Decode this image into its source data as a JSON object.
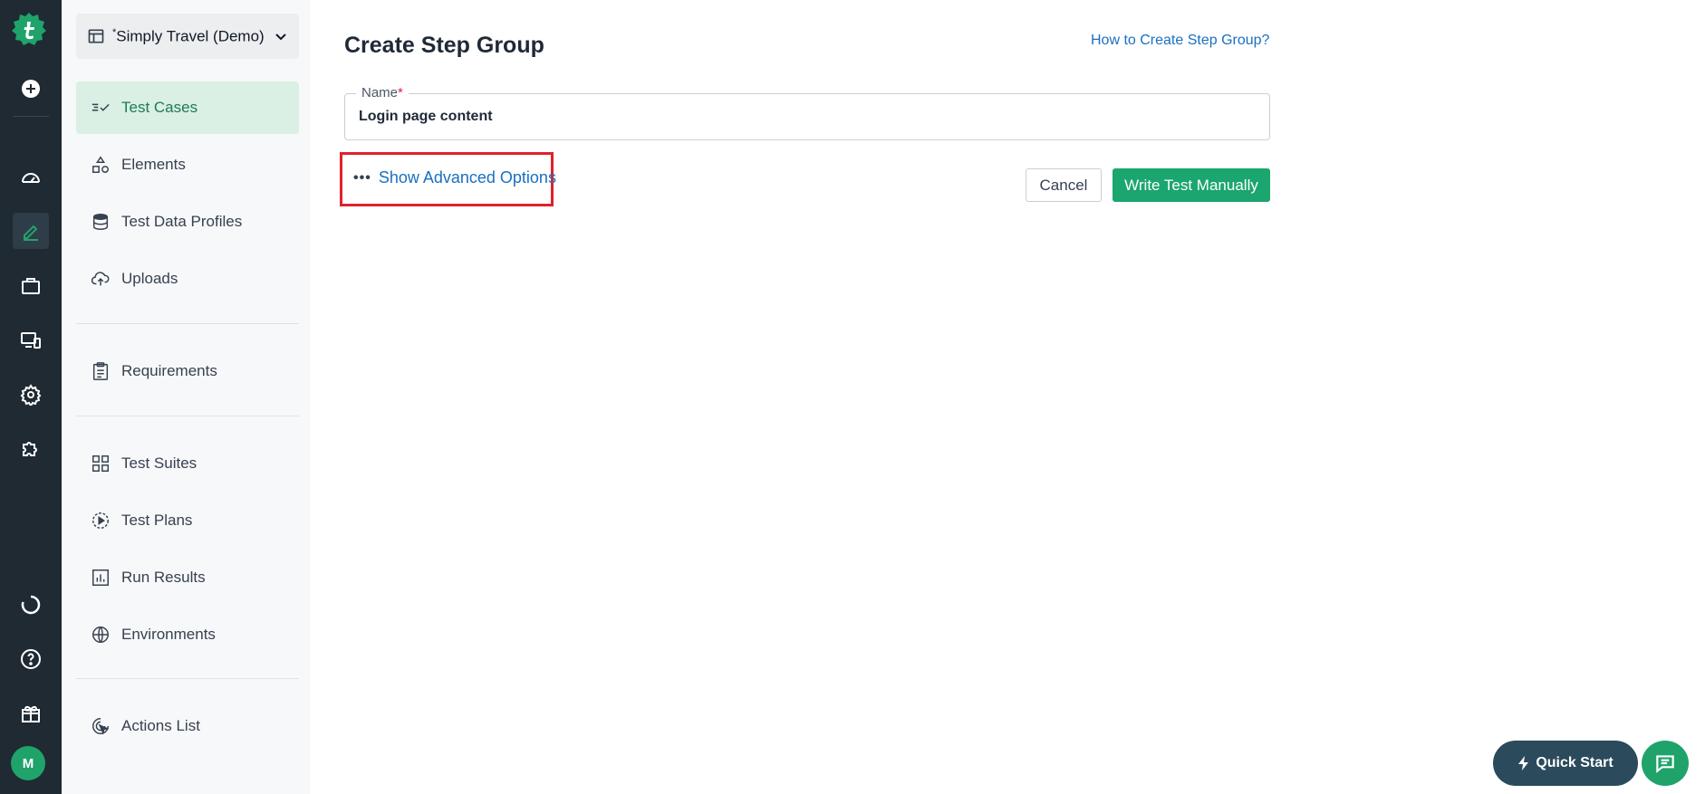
{
  "rail": {
    "icons": [
      "logo-icon",
      "add-icon",
      "dashboard-icon",
      "edit-icon",
      "briefcase-icon",
      "devices-icon",
      "settings-icon",
      "addons-icon",
      "refresh-icon",
      "help-icon",
      "gift-icon"
    ],
    "avatar_initial": "M"
  },
  "sidebar": {
    "project_prefix": "*",
    "project_name": "Simply Travel (Demo)",
    "items": [
      {
        "label": "Test Cases",
        "icon": "test-cases-icon",
        "active": true
      },
      {
        "label": "Elements",
        "icon": "elements-icon"
      },
      {
        "label": "Test Data Profiles",
        "icon": "database-icon"
      },
      {
        "label": "Uploads",
        "icon": "cloud-upload-icon"
      },
      {
        "label": "Requirements",
        "icon": "clipboard-icon"
      },
      {
        "label": "Test Suites",
        "icon": "grid-icon"
      },
      {
        "label": "Test Plans",
        "icon": "play-circle-icon"
      },
      {
        "label": "Run Results",
        "icon": "bar-chart-icon"
      },
      {
        "label": "Environments",
        "icon": "globe-icon"
      },
      {
        "label": "Actions List",
        "icon": "cursor-click-icon"
      }
    ]
  },
  "main": {
    "title": "Create Step Group",
    "help_link": "How to Create Step Group?",
    "name_label": "Name",
    "name_required": "*",
    "name_value": "Login page content",
    "advanced_dots": "•••",
    "advanced_label": "Show Advanced Options",
    "cancel_label": "Cancel",
    "submit_label": "Write Test Manually"
  },
  "floating": {
    "quick_start_label": "Quick Start"
  },
  "colors": {
    "rail_bg": "#1f2a33",
    "accent_green": "#1ba56f",
    "link_blue": "#1a6fc2",
    "highlight_red": "#e1202c",
    "quick_start_bg": "#2b4a5b"
  }
}
